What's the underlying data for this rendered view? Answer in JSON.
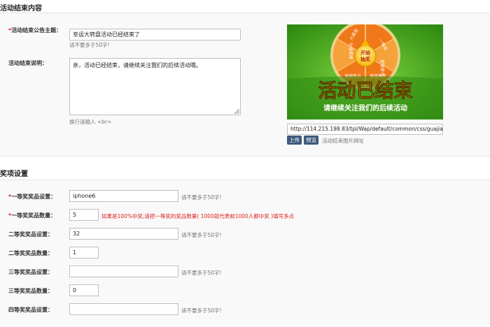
{
  "end_section": {
    "title": "活动结束内容",
    "announcement": {
      "required_mark": "*",
      "label": "活动结束公告主题：",
      "value": "幸运大转盘活动已经结束了",
      "hint": "请不要多于50字!"
    },
    "description": {
      "label": "活动结束说明：",
      "value": "亲，活动已经结束，请继续关注我们的后续活动哦。",
      "hint": "换行请输入 <br>"
    },
    "image": {
      "headline": "活动已结束",
      "subline": "请继续关注我们的后续活动",
      "wheel_center": "开始\n抽奖",
      "wheel_segments": [
        "一等奖",
        "谢谢参与",
        "再接再厉",
        "谢谢参与",
        "谢谢参与",
        "六等奖"
      ],
      "url": "http://114.215.198.83/tpl/Wap/default/common/css/guajiang/images/activity-lottery-end.jpg",
      "upload_label": "上传",
      "preview_label": "预览",
      "caption": "活动结束图片网址"
    }
  },
  "prize_section": {
    "title": "奖项设置",
    "rows": [
      {
        "required": true,
        "label": "一等奖奖品设置：",
        "value": "iphone6",
        "wide": true,
        "hint": "请不要多于50字!",
        "hint_red": false
      },
      {
        "required": true,
        "label": "一等奖奖品数量：",
        "value": "5",
        "wide": false,
        "hint": "如果是100%中奖,请把一等奖的奖品数量( 1000就代表前1000人都中奖 )填写多点",
        "hint_red": true
      },
      {
        "required": false,
        "label": "二等奖奖品设置：",
        "value": "32",
        "wide": true,
        "hint": "请不要多于50字!",
        "hint_red": false
      },
      {
        "required": false,
        "label": "二等奖奖品数量：",
        "value": "1",
        "wide": false,
        "hint": "",
        "hint_red": false
      },
      {
        "required": false,
        "label": "三等奖奖品设置：",
        "value": "",
        "wide": true,
        "hint": "请不要多于50字!",
        "hint_red": false
      },
      {
        "required": false,
        "label": "三等奖奖品数量：",
        "value": "0",
        "wide": false,
        "hint": "",
        "hint_red": false
      },
      {
        "required": false,
        "label": "四等奖奖品设置：",
        "value": "",
        "wide": true,
        "hint": "请不要多于50字!",
        "hint_red": false
      }
    ]
  },
  "colors": {
    "required": "#e02020",
    "button": "#3d5a7a",
    "banner_green": "#3d9a17",
    "wheel_orange": "#f07818",
    "headline_yellow": "#ffe600"
  }
}
